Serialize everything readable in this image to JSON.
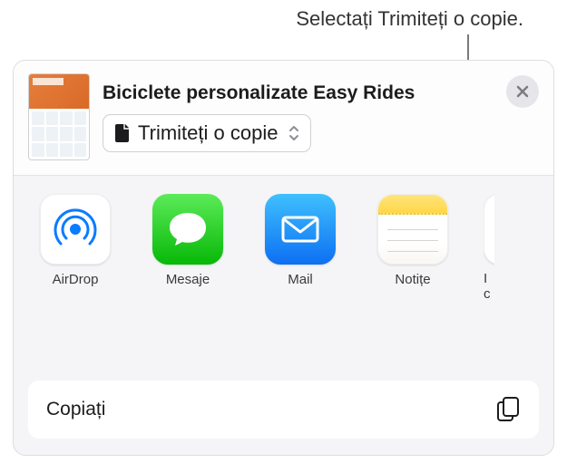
{
  "callout": {
    "text": "Selectați Trimiteți o copie."
  },
  "header": {
    "document_title": "Biciclete personalizate Easy Rides",
    "option_label": "Trimiteți o copie"
  },
  "apps": [
    {
      "label": "AirDrop"
    },
    {
      "label": "Mesaje"
    },
    {
      "label": "Mail"
    },
    {
      "label": "Notițe"
    }
  ],
  "partial_app": {
    "label_line1": "I",
    "label_line2": "c"
  },
  "actions": {
    "copy_label": "Copiați"
  }
}
